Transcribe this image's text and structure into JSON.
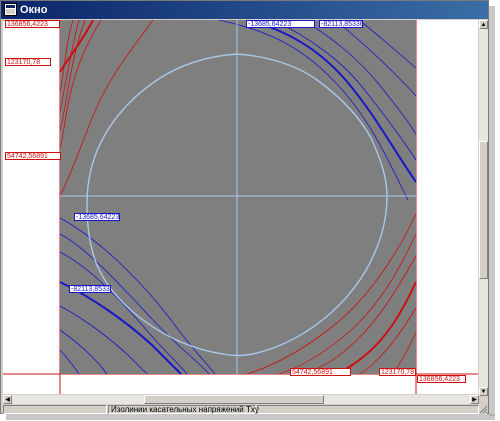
{
  "window": {
    "title": "Окно"
  },
  "plot": {
    "background": "#7f7f7f",
    "axis_color": "#a8c8e8",
    "labels": {
      "top_left": "136856,4223",
      "left_upper": "123170,78",
      "left_mid": "54742,56891",
      "left_lower_blue": "-13685,64223",
      "left_bottom_blue": "-82113,85336",
      "top_blue_1": "-13685,64223",
      "top_blue_2": "-82113,85336",
      "bottom_red_1": "54742,56891",
      "bottom_red_2": "123170,78",
      "bottom_right": "136856,4223"
    },
    "colors": {
      "positive": "#cc1010",
      "negative": "#1818c8",
      "zero": "#a8c8e8"
    }
  },
  "status": {
    "text": "Изолинии касательных напряжений Txy"
  }
}
